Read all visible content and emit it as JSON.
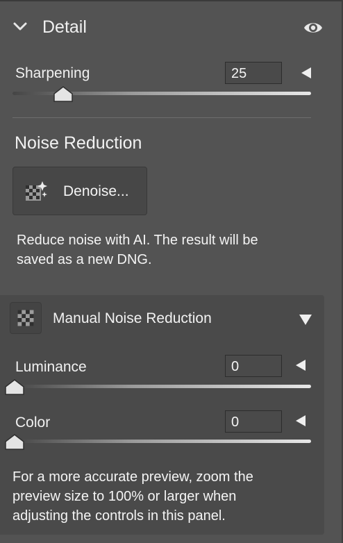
{
  "header": {
    "title": "Detail",
    "collapse_icon": "chevron-down-icon",
    "visibility_icon": "eye-icon"
  },
  "sharpening": {
    "label": "Sharpening",
    "value": "25",
    "level": 0.25
  },
  "noise_reduction": {
    "title": "Noise Reduction",
    "denoise_button_label": "Denoise...",
    "denoise_icon": "ai-denoise-icon",
    "description_line1": "Reduce noise with AI. The result will be",
    "description_line2": "saved as a new DNG."
  },
  "manual_noise_reduction": {
    "title": "Manual Noise Reduction",
    "icon": "noise-pattern-icon",
    "luminance": {
      "label": "Luminance",
      "value": "0",
      "level": 0
    },
    "color": {
      "label": "Color",
      "value": "0",
      "level": 0
    },
    "note_line1": "For a more accurate preview, zoom the",
    "note_line2": "preview size to 100% or larger when",
    "note_line3": "adjusting the controls in this panel."
  },
  "colors": {
    "background": "#535353",
    "subpanel": "#4a4a4a",
    "text": "#ececec"
  }
}
